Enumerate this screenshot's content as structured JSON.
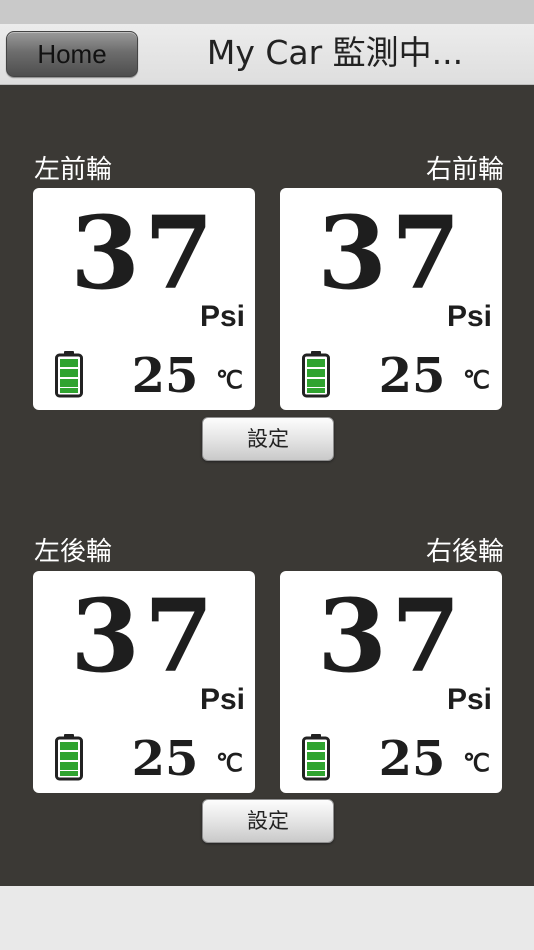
{
  "nav": {
    "home_label": "Home",
    "title": "My Car 監測中..."
  },
  "front": {
    "left": {
      "label": "左前輪",
      "pressure": "37",
      "pressure_unit": "Psi",
      "temperature": "25",
      "temperature_unit": "℃"
    },
    "right": {
      "label": "右前輪",
      "pressure": "37",
      "pressure_unit": "Psi",
      "temperature": "25",
      "temperature_unit": "℃"
    },
    "settings_label": "設定"
  },
  "rear": {
    "left": {
      "label": "左後輪",
      "pressure": "37",
      "pressure_unit": "Psi",
      "temperature": "25",
      "temperature_unit": "℃"
    },
    "right": {
      "label": "右後輪",
      "pressure": "37",
      "pressure_unit": "Psi",
      "temperature": "25",
      "temperature_unit": "℃"
    },
    "settings_label": "設定"
  },
  "colors": {
    "background": "#3b3935",
    "battery_green": "#2fa32f",
    "card": "#ffffff"
  },
  "battery_level": 1.0
}
